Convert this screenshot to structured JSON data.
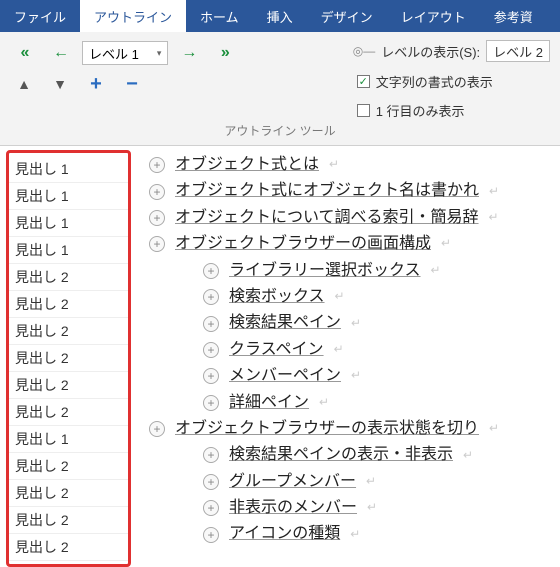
{
  "tabs": {
    "file": "ファイル",
    "outline": "アウトライン",
    "home": "ホーム",
    "insert": "挿入",
    "design": "デザイン",
    "layout": "レイアウト",
    "references": "参考資"
  },
  "ribbon": {
    "level_value": "レベル 1",
    "show_level_label": "レベルの表示(S):",
    "show_level_value": "レベル 2",
    "show_formatting_label": "文字列の書式の表示",
    "show_first_line_label": "1 行目のみ表示",
    "group_label": "アウトライン ツール"
  },
  "style_pane": {
    "items": [
      "見出し 1",
      "見出し 1",
      "見出し 1",
      "見出し 1",
      "見出し 2",
      "見出し 2",
      "見出し 2",
      "見出し 2",
      "見出し 2",
      "見出し 2",
      "見出し 1",
      "見出し 2",
      "見出し 2",
      "見出し 2",
      "見出し 2"
    ]
  },
  "outline": {
    "rows": [
      {
        "level": 1,
        "text": "オブジェクト式とは"
      },
      {
        "level": 1,
        "text": "オブジェクト式にオブジェクト名は書かれ"
      },
      {
        "level": 1,
        "text": "オブジェクトについて調べる索引・簡易辞"
      },
      {
        "level": 1,
        "text": "オブジェクトブラウザーの画面構成"
      },
      {
        "level": 2,
        "text": "ライブラリー選択ボックス"
      },
      {
        "level": 2,
        "text": "検索ボックス"
      },
      {
        "level": 2,
        "text": "検索結果ペイン"
      },
      {
        "level": 2,
        "text": "クラスペイン"
      },
      {
        "level": 2,
        "text": "メンバーペイン"
      },
      {
        "level": 2,
        "text": "詳細ペイン"
      },
      {
        "level": 1,
        "text": "オブジェクトブラウザーの表示状態を切り"
      },
      {
        "level": 2,
        "text": "検索結果ペインの表示・非表示"
      },
      {
        "level": 2,
        "text": "グループメンバー"
      },
      {
        "level": 2,
        "text": "非表示のメンバー"
      },
      {
        "level": 2,
        "text": "アイコンの種類"
      }
    ]
  }
}
